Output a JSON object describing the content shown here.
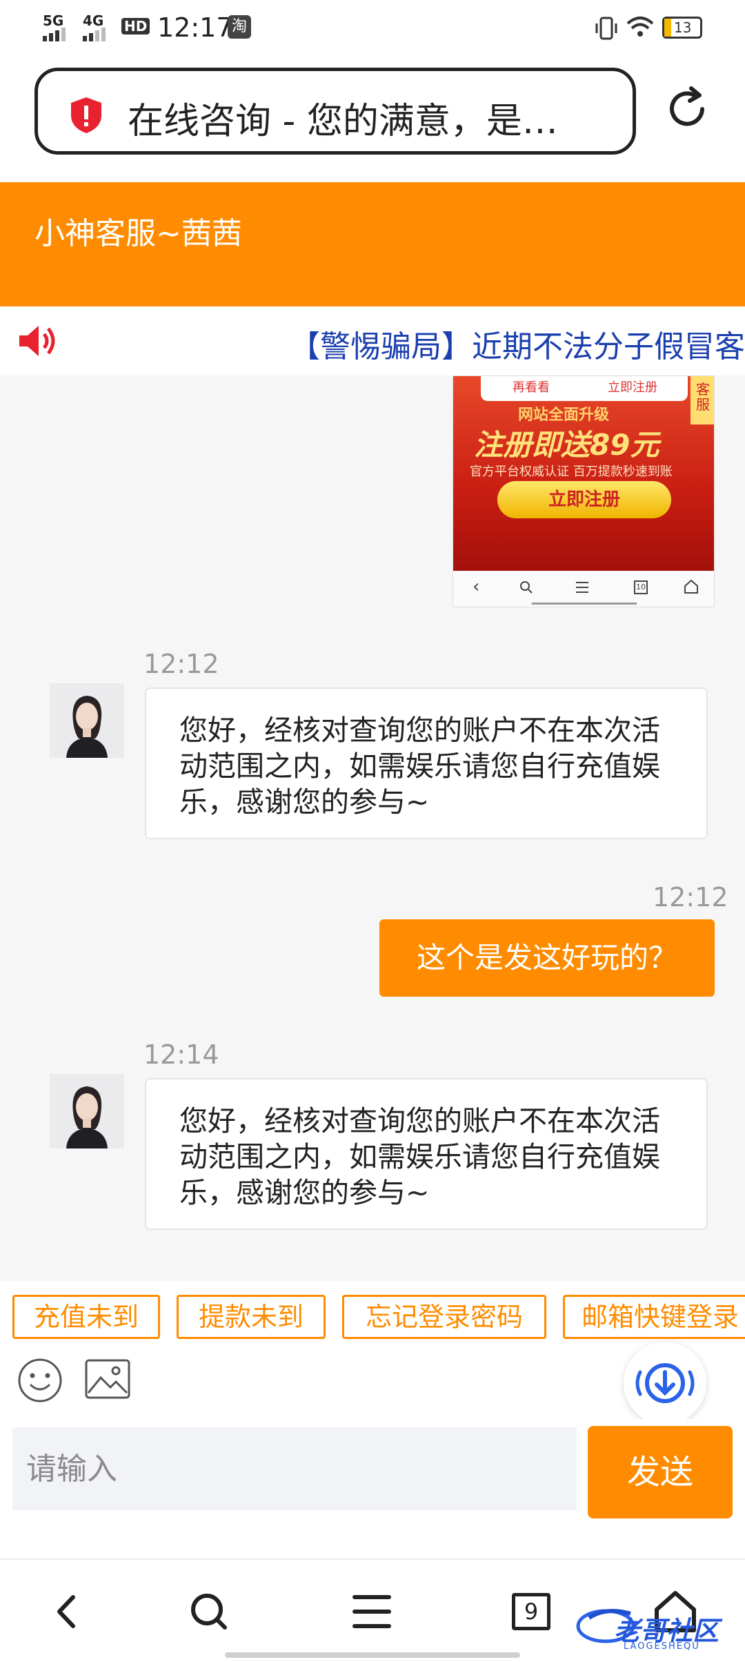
{
  "status_bar": {
    "signal_1": "5G",
    "signal_2": "4G",
    "hd": "HD",
    "time": "12:17",
    "app_badge": "淘",
    "battery": "13"
  },
  "address_bar": {
    "title": "在线咨询 - 您的满意，是…"
  },
  "header": {
    "title": "小神客服~茜茜"
  },
  "notice": {
    "text": "【警惕骗局】近期不法分子假冒客"
  },
  "screenshot_image": {
    "btn_left": "再看看",
    "btn_right": "立即注册",
    "line1": "网站全面升级",
    "headline": "注册即送89元",
    "sub": "官方平台权威认证  百万提款秒速到账",
    "register": "立即注册",
    "side_tag": "客服",
    "tab_count": "10"
  },
  "messages": [
    {
      "time": "12:12",
      "direction": "in",
      "text": "您好，经核对查询您的账户不在本次活动范围之内，如需娱乐请您自行充值娱乐，感谢您的参与~"
    },
    {
      "time": "12:12",
      "direction": "out",
      "text": "这个是发这好玩的？"
    },
    {
      "time": "12:14",
      "direction": "in",
      "text": "您好，经核对查询您的账户不在本次活动范围之内，如需娱乐请您自行充值娱乐，感谢您的参与~"
    }
  ],
  "quick_replies": [
    "充值未到",
    "提款未到",
    "忘记登录密码",
    "邮箱快键登录"
  ],
  "input": {
    "placeholder": "请输入"
  },
  "send_label": "发送",
  "bottom_nav": {
    "tab_count": "9"
  },
  "watermark": {
    "text": "老哥社区",
    "sub": "LAOGESHEQU"
  },
  "colors": {
    "accent": "#ff8c00",
    "notice_text": "#1a3fae",
    "alert": "#e8222e"
  },
  "icons": [
    "shield-icon",
    "reload-icon",
    "speaker-icon",
    "emoji-icon",
    "image-icon",
    "download-icon",
    "back-icon",
    "search-icon",
    "menu-icon",
    "tabs-icon",
    "home-icon"
  ]
}
